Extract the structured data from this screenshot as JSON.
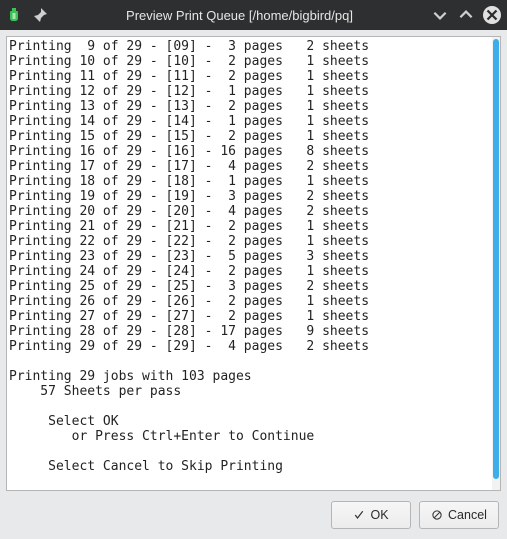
{
  "titlebar": {
    "title": "Preview Print Queue  [/home/bigbird/pq]"
  },
  "log": {
    "rows": [
      {
        "n": 9,
        "total": 29,
        "id": "09",
        "pages": 3,
        "sheets": 2
      },
      {
        "n": 10,
        "total": 29,
        "id": "10",
        "pages": 2,
        "sheets": 1
      },
      {
        "n": 11,
        "total": 29,
        "id": "11",
        "pages": 2,
        "sheets": 1
      },
      {
        "n": 12,
        "total": 29,
        "id": "12",
        "pages": 1,
        "sheets": 1
      },
      {
        "n": 13,
        "total": 29,
        "id": "13",
        "pages": 2,
        "sheets": 1
      },
      {
        "n": 14,
        "total": 29,
        "id": "14",
        "pages": 1,
        "sheets": 1
      },
      {
        "n": 15,
        "total": 29,
        "id": "15",
        "pages": 2,
        "sheets": 1
      },
      {
        "n": 16,
        "total": 29,
        "id": "16",
        "pages": 16,
        "sheets": 8
      },
      {
        "n": 17,
        "total": 29,
        "id": "17",
        "pages": 4,
        "sheets": 2
      },
      {
        "n": 18,
        "total": 29,
        "id": "18",
        "pages": 1,
        "sheets": 1
      },
      {
        "n": 19,
        "total": 29,
        "id": "19",
        "pages": 3,
        "sheets": 2
      },
      {
        "n": 20,
        "total": 29,
        "id": "20",
        "pages": 4,
        "sheets": 2
      },
      {
        "n": 21,
        "total": 29,
        "id": "21",
        "pages": 2,
        "sheets": 1
      },
      {
        "n": 22,
        "total": 29,
        "id": "22",
        "pages": 2,
        "sheets": 1
      },
      {
        "n": 23,
        "total": 29,
        "id": "23",
        "pages": 5,
        "sheets": 3
      },
      {
        "n": 24,
        "total": 29,
        "id": "24",
        "pages": 2,
        "sheets": 1
      },
      {
        "n": 25,
        "total": 29,
        "id": "25",
        "pages": 3,
        "sheets": 2
      },
      {
        "n": 26,
        "total": 29,
        "id": "26",
        "pages": 2,
        "sheets": 1
      },
      {
        "n": 27,
        "total": 29,
        "id": "27",
        "pages": 2,
        "sheets": 1
      },
      {
        "n": 28,
        "total": 29,
        "id": "28",
        "pages": 17,
        "sheets": 9
      },
      {
        "n": 29,
        "total": 29,
        "id": "29",
        "pages": 4,
        "sheets": 2
      }
    ],
    "summary": {
      "line1": "Printing 29 jobs with 103 pages",
      "line2": "    57 Sheets per pass",
      "line3": "     Select OK",
      "line4": "        or Press Ctrl+Enter to Continue",
      "line5": "     Select Cancel to Skip Printing"
    }
  },
  "buttons": {
    "ok": "OK",
    "cancel": "Cancel"
  }
}
